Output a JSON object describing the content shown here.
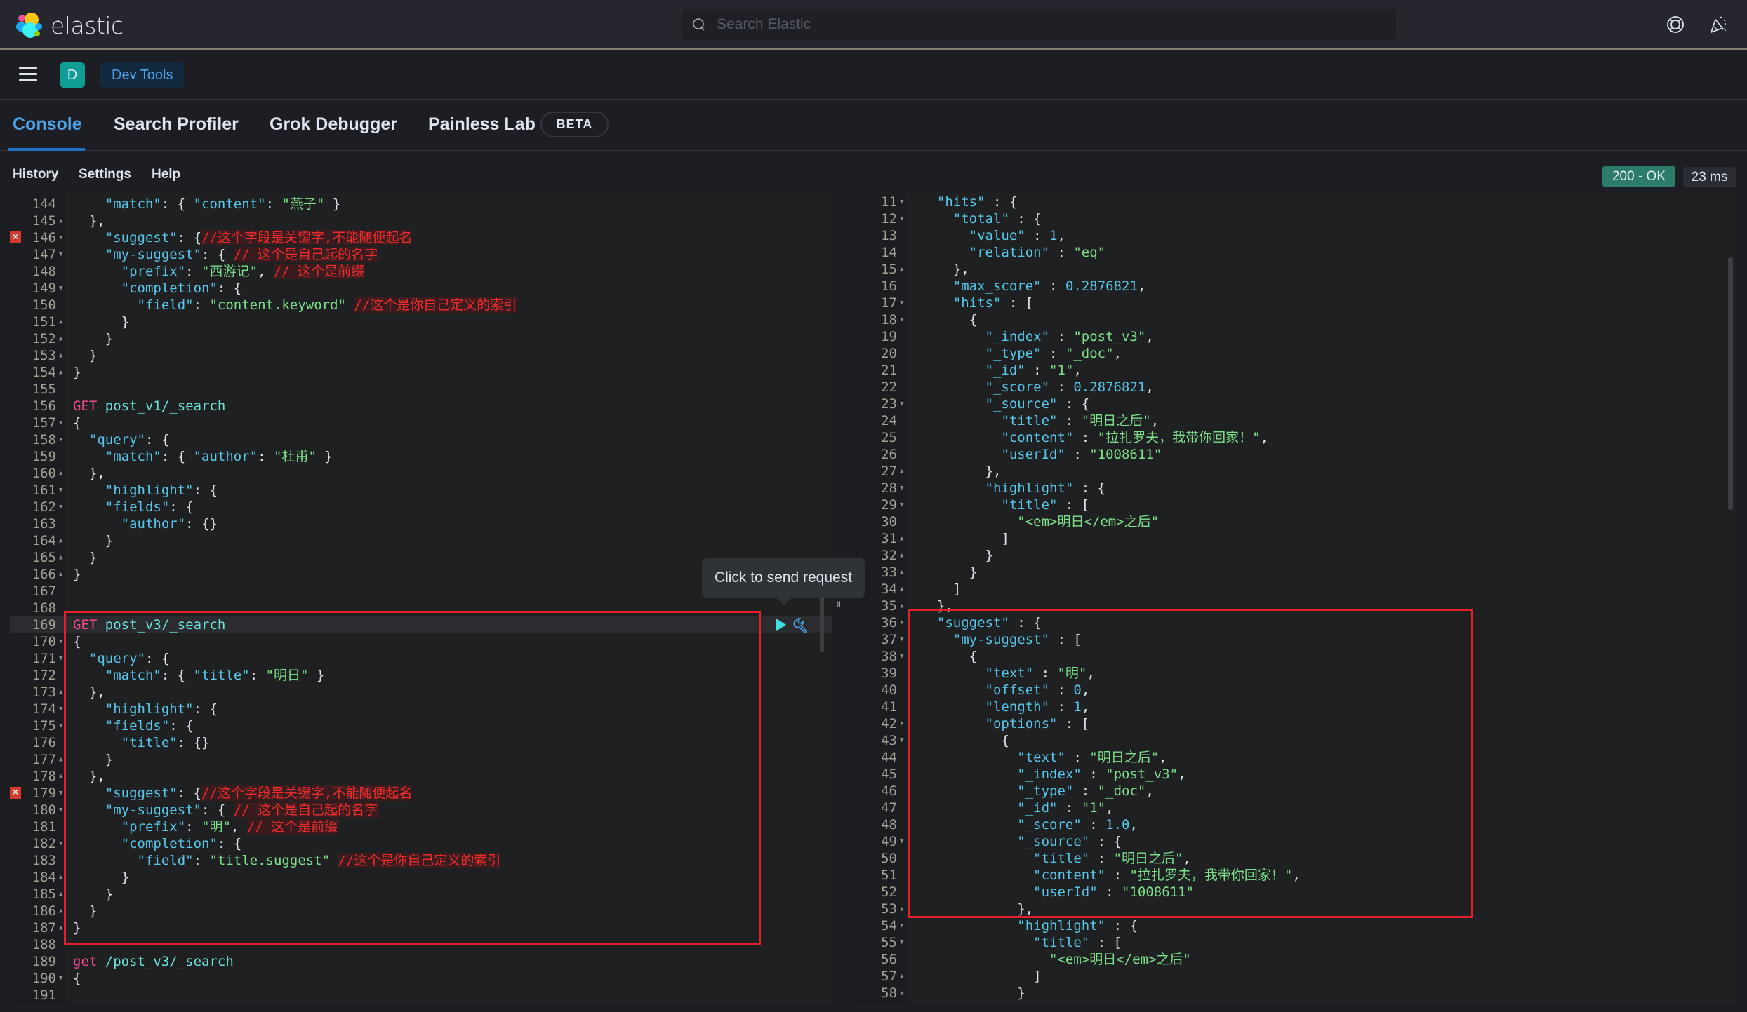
{
  "header": {
    "logo_text": "elastic",
    "search_placeholder": "Search Elastic",
    "icons": [
      "help-lifebuoy-icon",
      "newsfeed-party-icon"
    ]
  },
  "breadcrumb": {
    "avatar_letter": "D",
    "current": "Dev Tools"
  },
  "tabs": [
    {
      "label": "Console",
      "active": true
    },
    {
      "label": "Search Profiler",
      "active": false
    },
    {
      "label": "Grok Debugger",
      "active": false
    },
    {
      "label": "Painless Lab",
      "active": false,
      "badge": "BETA"
    }
  ],
  "subnav": {
    "links": [
      "History",
      "Settings",
      "Help"
    ],
    "status": "200 - OK",
    "status_color": "#2c7c6b",
    "time": "23 ms"
  },
  "tooltip": "Click to send request",
  "request_editor": {
    "lines": [
      {
        "n": "144",
        "fold": "",
        "html": "    <span class=\"k\">\"match\"</span>: { <span class=\"k\">\"content\"</span>: <span class=\"s\">\"燕子\"</span> }"
      },
      {
        "n": "145",
        "fold": "▲",
        "html": "  },"
      },
      {
        "n": "146",
        "fold": "▼",
        "err": true,
        "html": "    <span class=\"k\">\"suggest\"</span>: {<span class=\"c\">//这个字段是关键字,不能随便起名</span>"
      },
      {
        "n": "147",
        "fold": "▼",
        "html": "    <span class=\"k\">\"my-suggest\"</span>: { <span class=\"c\">// 这个是自己起的名字</span>"
      },
      {
        "n": "148",
        "fold": "",
        "html": "      <span class=\"k\">\"prefix\"</span>: <span class=\"s\">\"西游记\"</span>, <span class=\"c\">// 这个是前缀</span>"
      },
      {
        "n": "149",
        "fold": "▼",
        "html": "      <span class=\"k\">\"completion\"</span>: {"
      },
      {
        "n": "150",
        "fold": "",
        "html": "        <span class=\"k\">\"field\"</span>: <span class=\"s\">\"content.keyword\"</span> <span class=\"c\">//这个是你自己定义的索引</span>"
      },
      {
        "n": "151",
        "fold": "▲",
        "html": "      }"
      },
      {
        "n": "152",
        "fold": "▲",
        "html": "    }"
      },
      {
        "n": "153",
        "fold": "▲",
        "html": "  }"
      },
      {
        "n": "154",
        "fold": "▲",
        "html": "}"
      },
      {
        "n": "155",
        "fold": "",
        "html": ""
      },
      {
        "n": "156",
        "fold": "",
        "html": "<span class=\"m\">GET</span> <span class=\"u\">post_v1/_search</span>"
      },
      {
        "n": "157",
        "fold": "▼",
        "html": "{"
      },
      {
        "n": "158",
        "fold": "▼",
        "html": "  <span class=\"k\">\"query\"</span>: {"
      },
      {
        "n": "159",
        "fold": "",
        "html": "    <span class=\"k\">\"match\"</span>: { <span class=\"k\">\"author\"</span>: <span class=\"s\">\"杜甫\"</span> }"
      },
      {
        "n": "160",
        "fold": "▲",
        "html": "  },"
      },
      {
        "n": "161",
        "fold": "▼",
        "html": "    <span class=\"k\">\"highlight\"</span>: {"
      },
      {
        "n": "162",
        "fold": "▼",
        "html": "    <span class=\"k\">\"fields\"</span>: {"
      },
      {
        "n": "163",
        "fold": "",
        "html": "      <span class=\"k\">\"author\"</span>: {}"
      },
      {
        "n": "164",
        "fold": "▲",
        "html": "    }"
      },
      {
        "n": "165",
        "fold": "▲",
        "html": "  }"
      },
      {
        "n": "166",
        "fold": "▲",
        "html": "}"
      },
      {
        "n": "167",
        "fold": "",
        "html": ""
      },
      {
        "n": "168",
        "fold": "",
        "html": ""
      },
      {
        "n": "169",
        "fold": "",
        "active": true,
        "html": "<span class=\"m\">GET</span> <span class=\"u\">post_v3/_search</span>"
      },
      {
        "n": "170",
        "fold": "▼",
        "html": "{"
      },
      {
        "n": "171",
        "fold": "▼",
        "html": "  <span class=\"k\">\"query\"</span>: {"
      },
      {
        "n": "172",
        "fold": "",
        "html": "    <span class=\"k\">\"match\"</span>: { <span class=\"k\">\"title\"</span>: <span class=\"s\">\"明日\"</span> }"
      },
      {
        "n": "173",
        "fold": "▲",
        "html": "  },"
      },
      {
        "n": "174",
        "fold": "▼",
        "html": "    <span class=\"k\">\"highlight\"</span>: {"
      },
      {
        "n": "175",
        "fold": "▼",
        "html": "    <span class=\"k\">\"fields\"</span>: {"
      },
      {
        "n": "176",
        "fold": "",
        "html": "      <span class=\"k\">\"title\"</span>: {}"
      },
      {
        "n": "177",
        "fold": "▲",
        "html": "    }"
      },
      {
        "n": "178",
        "fold": "▲",
        "html": "  },"
      },
      {
        "n": "179",
        "fold": "▼",
        "err": true,
        "html": "    <span class=\"k\">\"suggest\"</span>: {<span class=\"c\">//这个字段是关键字,不能随便起名</span>"
      },
      {
        "n": "180",
        "fold": "▼",
        "html": "    <span class=\"k\">\"my-suggest\"</span>: { <span class=\"c\">// 这个是自己起的名字</span>"
      },
      {
        "n": "181",
        "fold": "",
        "html": "      <span class=\"k\">\"prefix\"</span>: <span class=\"s\">\"明\"</span>, <span class=\"c\">// 这个是前缀</span>"
      },
      {
        "n": "182",
        "fold": "▼",
        "html": "      <span class=\"k\">\"completion\"</span>: {"
      },
      {
        "n": "183",
        "fold": "",
        "html": "        <span class=\"k\">\"field\"</span>: <span class=\"s\">\"title.suggest\"</span> <span class=\"c\">//这个是你自己定义的索引</span>"
      },
      {
        "n": "184",
        "fold": "▲",
        "html": "      }"
      },
      {
        "n": "185",
        "fold": "▲",
        "html": "    }"
      },
      {
        "n": "186",
        "fold": "▲",
        "html": "  }"
      },
      {
        "n": "187",
        "fold": "▲",
        "html": "}"
      },
      {
        "n": "188",
        "fold": "",
        "html": ""
      },
      {
        "n": "189",
        "fold": "",
        "html": "<span class=\"m\">get</span> <span class=\"u\">/post_v3/_search</span>"
      },
      {
        "n": "190",
        "fold": "▼",
        "html": "{"
      },
      {
        "n": "191",
        "fold": "",
        "html": ""
      }
    ]
  },
  "response_viewer": {
    "lines": [
      {
        "n": "11",
        "fold": "▼",
        "html": "  <span class=\"k\">\"hits\"</span> : {"
      },
      {
        "n": "12",
        "fold": "▼",
        "html": "    <span class=\"k\">\"total\"</span> : {"
      },
      {
        "n": "13",
        "fold": "",
        "html": "      <span class=\"k\">\"value\"</span> : <span class=\"n\">1</span>,"
      },
      {
        "n": "14",
        "fold": "",
        "html": "      <span class=\"k\">\"relation\"</span> : <span class=\"s\">\"eq\"</span>"
      },
      {
        "n": "15",
        "fold": "▲",
        "html": "    },"
      },
      {
        "n": "16",
        "fold": "",
        "html": "    <span class=\"k\">\"max_score\"</span> : <span class=\"n\">0.2876821</span>,"
      },
      {
        "n": "17",
        "fold": "▼",
        "html": "    <span class=\"k\">\"hits\"</span> : ["
      },
      {
        "n": "18",
        "fold": "▼",
        "html": "      {"
      },
      {
        "n": "19",
        "fold": "",
        "html": "        <span class=\"k\">\"_index\"</span> : <span class=\"s\">\"post_v3\"</span>,"
      },
      {
        "n": "20",
        "fold": "",
        "html": "        <span class=\"k\">\"_type\"</span> : <span class=\"s\">\"_doc\"</span>,"
      },
      {
        "n": "21",
        "fold": "",
        "html": "        <span class=\"k\">\"_id\"</span> : <span class=\"s\">\"1\"</span>,"
      },
      {
        "n": "22",
        "fold": "",
        "html": "        <span class=\"k\">\"_score\"</span> : <span class=\"n\">0.2876821</span>,"
      },
      {
        "n": "23",
        "fold": "▼",
        "html": "        <span class=\"k\">\"_source\"</span> : {"
      },
      {
        "n": "24",
        "fold": "",
        "html": "          <span class=\"k\">\"title\"</span> : <span class=\"s\">\"明日之后\"</span>,"
      },
      {
        "n": "25",
        "fold": "",
        "html": "          <span class=\"k\">\"content\"</span> : <span class=\"s\">\"拉扎罗夫，我带你回家！\"</span>,"
      },
      {
        "n": "26",
        "fold": "",
        "html": "          <span class=\"k\">\"userId\"</span> : <span class=\"s\">\"1008611\"</span>"
      },
      {
        "n": "27",
        "fold": "▲",
        "html": "        },"
      },
      {
        "n": "28",
        "fold": "▼",
        "html": "        <span class=\"k\">\"highlight\"</span> : {"
      },
      {
        "n": "29",
        "fold": "▼",
        "html": "          <span class=\"k\">\"title\"</span> : ["
      },
      {
        "n": "30",
        "fold": "",
        "html": "            <span class=\"s\">\"&lt;em&gt;明日&lt;/em&gt;之后\"</span>"
      },
      {
        "n": "31",
        "fold": "▲",
        "html": "          ]"
      },
      {
        "n": "32",
        "fold": "▲",
        "html": "        }"
      },
      {
        "n": "33",
        "fold": "▲",
        "html": "      }"
      },
      {
        "n": "34",
        "fold": "▲",
        "html": "    ]"
      },
      {
        "n": "35",
        "fold": "▲",
        "html": "  },"
      },
      {
        "n": "36",
        "fold": "▼",
        "html": "  <span class=\"k\">\"suggest\"</span> : {"
      },
      {
        "n": "37",
        "fold": "▼",
        "html": "    <span class=\"k\">\"my-suggest\"</span> : ["
      },
      {
        "n": "38",
        "fold": "▼",
        "html": "      {"
      },
      {
        "n": "39",
        "fold": "",
        "html": "        <span class=\"k\">\"text\"</span> : <span class=\"s\">\"明\"</span>,"
      },
      {
        "n": "40",
        "fold": "",
        "html": "        <span class=\"k\">\"offset\"</span> : <span class=\"n\">0</span>,"
      },
      {
        "n": "41",
        "fold": "",
        "html": "        <span class=\"k\">\"length\"</span> : <span class=\"n\">1</span>,"
      },
      {
        "n": "42",
        "fold": "▼",
        "html": "        <span class=\"k\">\"options\"</span> : ["
      },
      {
        "n": "43",
        "fold": "▼",
        "html": "          {"
      },
      {
        "n": "44",
        "fold": "",
        "html": "            <span class=\"k\">\"text\"</span> : <span class=\"s\">\"明日之后\"</span>,"
      },
      {
        "n": "45",
        "fold": "",
        "html": "            <span class=\"k\">\"_index\"</span> : <span class=\"s\">\"post_v3\"</span>,"
      },
      {
        "n": "46",
        "fold": "",
        "html": "            <span class=\"k\">\"_type\"</span> : <span class=\"s\">\"_doc\"</span>,"
      },
      {
        "n": "47",
        "fold": "",
        "html": "            <span class=\"k\">\"_id\"</span> : <span class=\"s\">\"1\"</span>,"
      },
      {
        "n": "48",
        "fold": "",
        "html": "            <span class=\"k\">\"_score\"</span> : <span class=\"n\">1.0</span>,"
      },
      {
        "n": "49",
        "fold": "▼",
        "html": "            <span class=\"k\">\"_source\"</span> : {"
      },
      {
        "n": "50",
        "fold": "",
        "html": "              <span class=\"k\">\"title\"</span> : <span class=\"s\">\"明日之后\"</span>,"
      },
      {
        "n": "51",
        "fold": "",
        "html": "              <span class=\"k\">\"content\"</span> : <span class=\"s\">\"拉扎罗夫，我带你回家！\"</span>,"
      },
      {
        "n": "52",
        "fold": "",
        "html": "              <span class=\"k\">\"userId\"</span> : <span class=\"s\">\"1008611\"</span>"
      },
      {
        "n": "53",
        "fold": "▲",
        "html": "            },"
      },
      {
        "n": "54",
        "fold": "▼",
        "html": "            <span class=\"k\">\"highlight\"</span> : {"
      },
      {
        "n": "55",
        "fold": "▼",
        "html": "              <span class=\"k\">\"title\"</span> : ["
      },
      {
        "n": "56",
        "fold": "",
        "html": "                <span class=\"s\">\"&lt;em&gt;明日&lt;/em&gt;之后\"</span>"
      },
      {
        "n": "57",
        "fold": "▲",
        "html": "              ]"
      },
      {
        "n": "58",
        "fold": "▲",
        "html": "            }"
      }
    ]
  }
}
